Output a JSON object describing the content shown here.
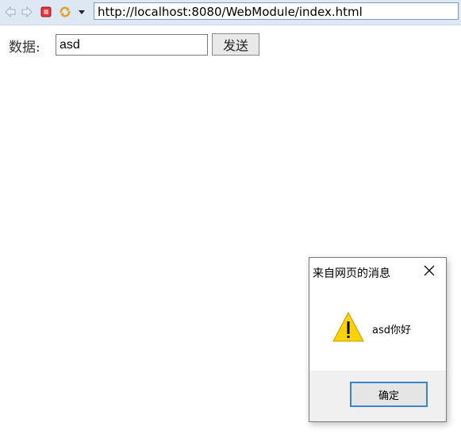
{
  "browser": {
    "url": "http://localhost:8080/WebModule/index.html",
    "icons": [
      "back-arrow-icon",
      "forward-arrow-icon",
      "stop-icon",
      "refresh-icon",
      "dropdown-arrow-icon"
    ]
  },
  "form": {
    "label": "数据:",
    "input_value": "asd",
    "send_label": "发送"
  },
  "dialog": {
    "title": "来自网页的消息",
    "message": "asd你好",
    "ok_label": "确定",
    "icon": "warning-icon"
  },
  "colors": {
    "toolbar_bg": "#dde8f4",
    "dialog_footer_bg": "#f0f0f0",
    "ok_border": "#3a84c8",
    "warning_fill": "#ffd200"
  }
}
